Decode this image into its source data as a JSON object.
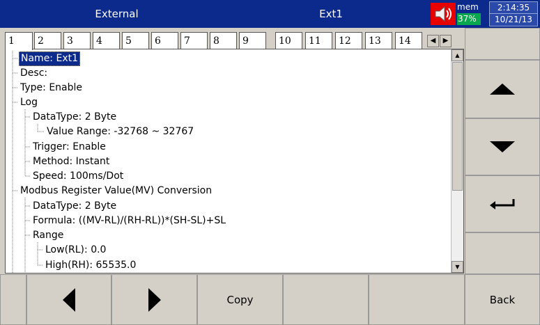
{
  "titlebar": {
    "app_title": "External",
    "group_title": "Ext1",
    "mem_label": "mem",
    "mem_percent": "37%",
    "time": "2:14:35",
    "date": "10/21/13"
  },
  "tabs": [
    "1",
    "2",
    "3",
    "4",
    "5",
    "6",
    "7",
    "8",
    "9",
    "10",
    "11",
    "12",
    "13",
    "14"
  ],
  "active_tab": "1",
  "tree": {
    "nodes": [
      "Name: Ext1",
      "Desc:",
      "Type: Enable",
      "Log",
      "DataType: 2 Byte",
      "Value Range: -32768 ~ 32767",
      "Trigger: Enable",
      "Method: Instant",
      "Speed: 100ms/Dot",
      "Modbus Register Value(MV) Conversion",
      "DataType: 2 Byte",
      "Formula: ((MV-RL)/(RH-RL))*(SH-SL)+SL",
      "Range",
      "Low(RL): 0.0",
      "High(RH): 65535.0"
    ]
  },
  "bottom": {
    "copy_label": "Copy",
    "back_label": "Back"
  },
  "icons": {
    "up": "arrow-up-icon",
    "down": "arrow-down-icon",
    "enter": "enter-icon",
    "left": "arrow-left-icon",
    "right": "arrow-right-icon",
    "speaker": "speaker-icon"
  },
  "colors": {
    "titlebar": "#0b2a8c",
    "mem_bar": "#0aa84e",
    "alarm": "#e60000",
    "selection": "#0b2a8c",
    "panel": "#d4d0c8"
  }
}
